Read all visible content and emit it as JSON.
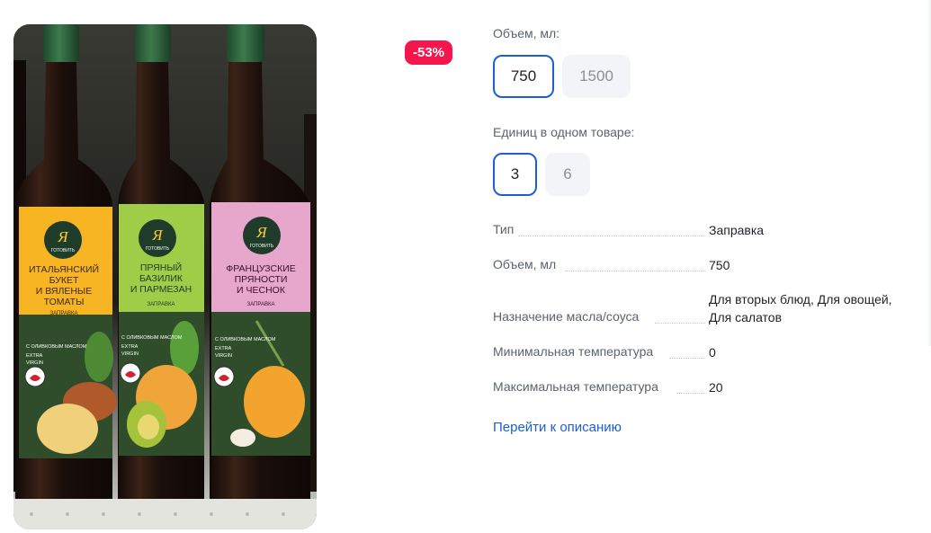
{
  "product": {
    "image_alt": "Я готовить заправки",
    "discount_badge": "-53%",
    "bottles": [
      {
        "brand": "Я",
        "brand_sub": "ГОТОВИТЬ",
        "line1": "ИТАЛЬЯНСКИЙ",
        "line2": "БУКЕТ",
        "line3": "И ВЯЛЕНЫЕ",
        "line4": "ТОМАТЫ",
        "kind": "ЗАПРАВКА",
        "label_color": "#f7b423",
        "cap_color": "#2e5d3c"
      },
      {
        "brand": "Я",
        "brand_sub": "ГОТОВИТЬ",
        "line1": "ПРЯНЫЙ",
        "line2": "БАЗИЛИК",
        "line3": "И ПАРМЕЗАН",
        "line4": "",
        "kind": "ЗАПРАВКА",
        "label_color": "#9fcd47",
        "cap_color": "#2e5d3c"
      },
      {
        "brand": "Я",
        "brand_sub": "ГОТОВИТЬ",
        "line1": "ФРАНЦУЗСКИЕ",
        "line2": "ПРЯНОСТИ",
        "line3": "И ЧЕСНОК",
        "line4": "",
        "kind": "ЗАПРАВКА",
        "label_color": "#e7a6cc",
        "cap_color": "#2e5d3c"
      }
    ],
    "bottle_small_text": {
      "a": "С ОЛИВКОВЫМ МАСЛОМ",
      "b": "EXTRA",
      "c": "VIRGIN"
    }
  },
  "options": {
    "volume": {
      "label": "Объем, мл:",
      "values": [
        "750",
        "1500"
      ],
      "selected": "750"
    },
    "units": {
      "label": "Единиц в одном товаре:",
      "values": [
        "3",
        "6"
      ],
      "selected": "3"
    }
  },
  "specs": [
    {
      "name": "Тип",
      "value": "Заправка"
    },
    {
      "name": "Объем, мл",
      "value": "750"
    },
    {
      "name": "Назначение масла/соуса",
      "value": "Для вторых блюд, Для овощей, Для салатов"
    },
    {
      "name": "Минимальная температура",
      "value": "0"
    },
    {
      "name": "Максимальная температура",
      "value": "20"
    }
  ],
  "description_link": "Перейти к описанию",
  "colors": {
    "accent": "#1b5fd6",
    "badge": "#f5164d",
    "label_text": "#5c6270"
  }
}
